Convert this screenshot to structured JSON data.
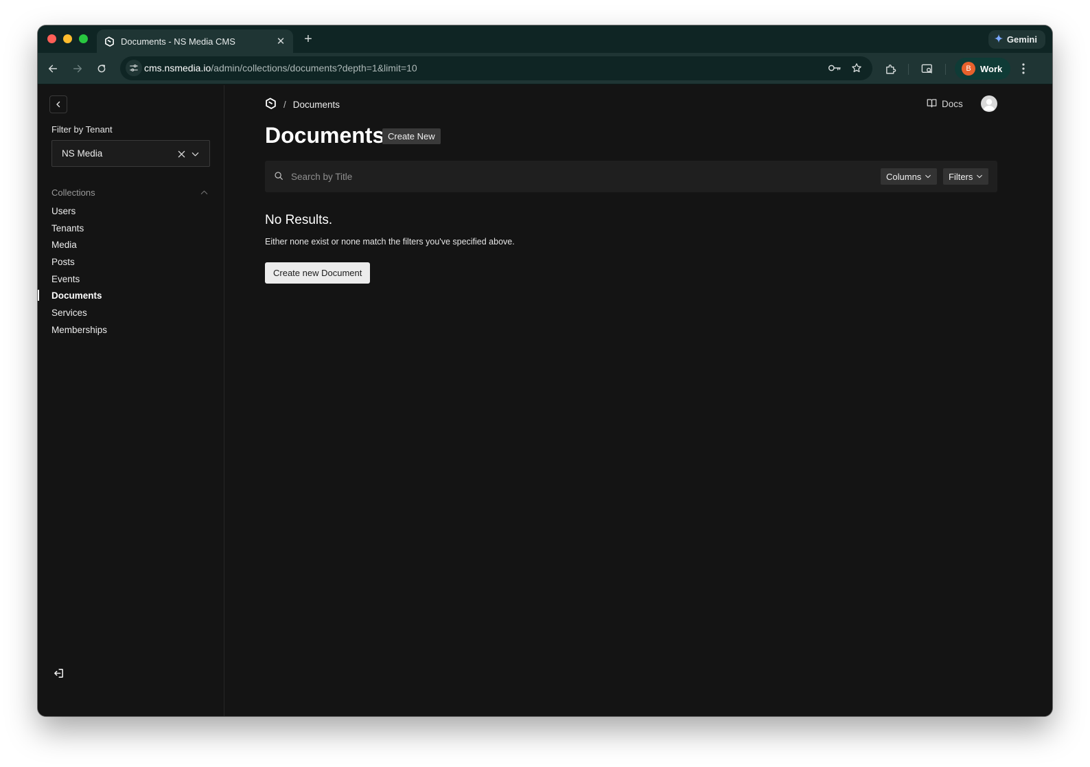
{
  "browser": {
    "tab_title": "Documents - NS Media CMS",
    "new_tab_label": "+",
    "gemini_label": "Gemini",
    "url_host": "cms.nsmedia.io",
    "url_path": "/admin/collections/documents?depth=1&limit=10",
    "profile_initial": "B",
    "profile_name": "Work"
  },
  "sidebar": {
    "filter_label": "Filter by Tenant",
    "tenant_value": "NS Media",
    "group_title": "Collections",
    "items": [
      {
        "label": "Users",
        "active": false
      },
      {
        "label": "Tenants",
        "active": false
      },
      {
        "label": "Media",
        "active": false
      },
      {
        "label": "Posts",
        "active": false
      },
      {
        "label": "Events",
        "active": false
      },
      {
        "label": "Documents",
        "active": true
      },
      {
        "label": "Services",
        "active": false
      },
      {
        "label": "Memberships",
        "active": false
      }
    ]
  },
  "header": {
    "breadcrumb_sep": "/",
    "breadcrumb_current": "Documents",
    "docs_label": "Docs"
  },
  "main": {
    "title": "Documents",
    "create_new_label": "Create New",
    "search_placeholder": "Search by Title",
    "columns_label": "Columns",
    "filters_label": "Filters",
    "empty_title": "No Results.",
    "empty_subtitle": "Either none exist or none match the filters you've specified above.",
    "create_document_label": "Create new Document"
  },
  "colors": {
    "page_bg": "#141414",
    "browser_chrome": "#1f3534",
    "profile_accent": "#e8612c"
  }
}
